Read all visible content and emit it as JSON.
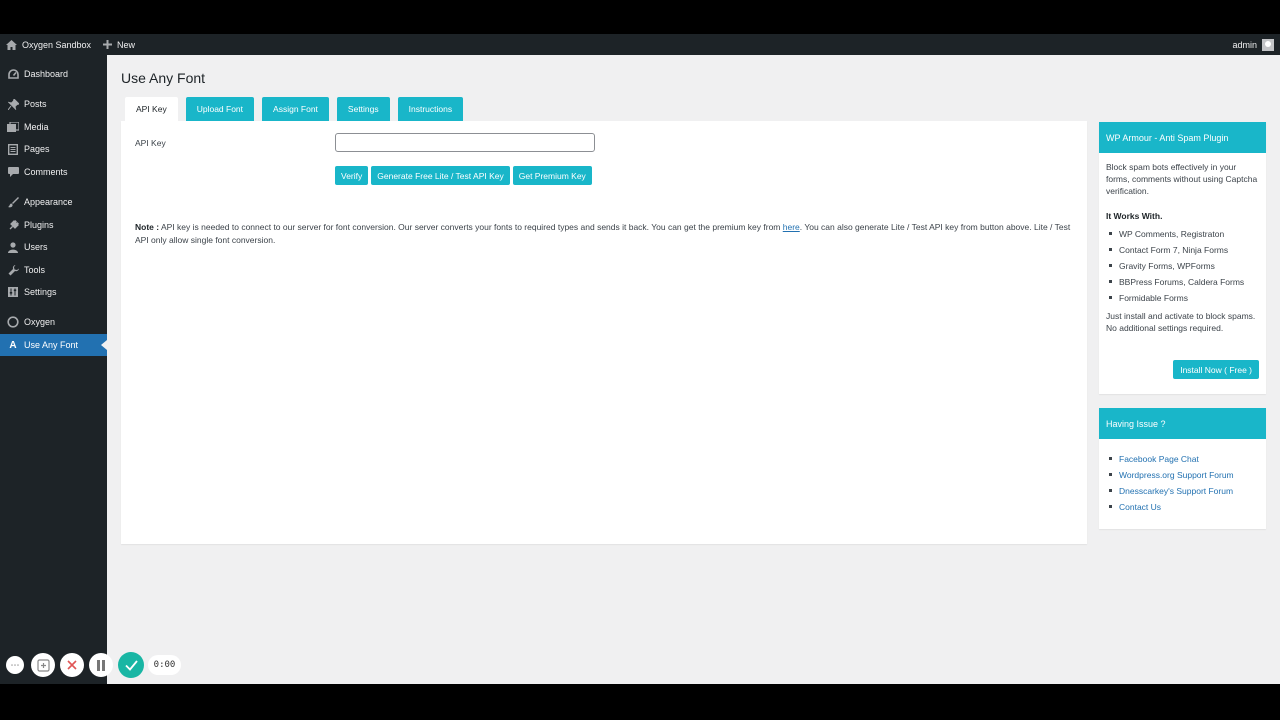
{
  "adminbar": {
    "site_name": "Oxygen Sandbox",
    "new_label": "New",
    "user": "admin"
  },
  "sidebar": {
    "items": [
      {
        "label": "Dashboard",
        "icon": "dashboard-icon"
      },
      {
        "label": "Posts",
        "icon": "pin-icon"
      },
      {
        "label": "Media",
        "icon": "media-icon"
      },
      {
        "label": "Pages",
        "icon": "page-icon"
      },
      {
        "label": "Comments",
        "icon": "comment-icon"
      },
      {
        "label": "Appearance",
        "icon": "brush-icon"
      },
      {
        "label": "Plugins",
        "icon": "plug-icon"
      },
      {
        "label": "Users",
        "icon": "user-icon"
      },
      {
        "label": "Tools",
        "icon": "wrench-icon"
      },
      {
        "label": "Settings",
        "icon": "sliders-icon"
      },
      {
        "label": "Oxygen",
        "icon": "oxygen-icon"
      },
      {
        "label": "Use Any Font",
        "icon": "font-a-icon",
        "active": true
      }
    ]
  },
  "main": {
    "title": "Use Any Font",
    "tabs": [
      "API Key",
      "Upload Font",
      "Assign Font",
      "Settings",
      "Instructions"
    ],
    "api_key_label": "API Key",
    "api_key_value": "",
    "buttons": {
      "verify": "Verify",
      "generate": "Generate Free Lite / Test API Key",
      "premium": "Get Premium Key"
    },
    "note": {
      "label": "Note :",
      "text_before": " API key is needed to connect to our server for font conversion. Our server converts your fonts to required types and sends it back. You can get the premium key from ",
      "link": "here",
      "text_after": ". You can also generate Lite / Test API key from button above. Lite / Test API only allow single font conversion."
    }
  },
  "wparmour": {
    "title": "WP Armour - Anti Spam Plugin",
    "intro": "Block spam bots effectively in your forms, comments without using Captcha verification.",
    "works_with": "It Works With.",
    "items": [
      "WP Comments, Registraton",
      "Contact Form 7, Ninja Forms",
      "Gravity Forms, WPForms",
      "BBPress Forums, Caldera Forms",
      "Formidable Forms"
    ],
    "outro": "Just install and activate to block spams. No additional settings required.",
    "install": "Install Now ( Free )"
  },
  "issue": {
    "title": "Having Issue ?",
    "links": [
      "Facebook Page Chat",
      "Wordpress.org Support Forum",
      "Dnesscarkey's Support Forum",
      "Contact Us"
    ]
  },
  "recorder": {
    "timer": "0:00"
  },
  "colors": {
    "accent": "#19b6c9",
    "admin_dark": "#1d2327",
    "active_menu": "#2271b1",
    "check": "#19b6a4",
    "close": "#e05555"
  }
}
